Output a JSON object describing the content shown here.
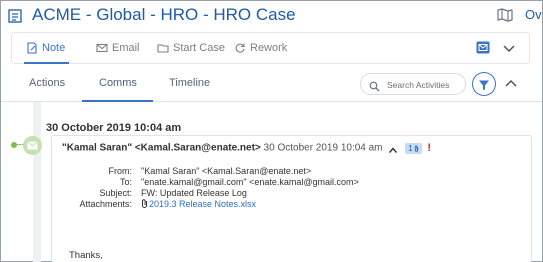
{
  "header": {
    "title": "ACME - Global - HRO - HRO Case",
    "overflow_text": "Ov"
  },
  "action_bar": {
    "buttons": [
      {
        "label": "Note",
        "icon": "note-icon"
      },
      {
        "label": "Email",
        "icon": "envelope-icon"
      },
      {
        "label": "Start Case",
        "icon": "folder-icon"
      },
      {
        "label": "Rework",
        "icon": "rework-icon"
      }
    ]
  },
  "tabs": [
    {
      "label": "Actions"
    },
    {
      "label": "Comms"
    },
    {
      "label": "Timeline"
    }
  ],
  "search": {
    "placeholder": "Search Activities"
  },
  "timeline": {
    "date_heading": "30 October 2019 10:04 am"
  },
  "email": {
    "sender": "\"Kamal Saran\" <Kamal.Saran@enate.net>",
    "date": "30 October 2019 10:04 am",
    "badge": "1",
    "important": "!",
    "labels": {
      "from": "From:",
      "to": "To:",
      "subject": "Subject:",
      "attachments": "Attachments:"
    },
    "from": "\"Kamal Saran\" <Kamal.Saran@enate.net>",
    "to": "\"enate.kamal@gmail.com\" <enate.kamal@gmail.com>",
    "subject": "FW: Updated Release Log",
    "attachment": "2019.3 Release Notes.xlsx",
    "body_start": "Thanks,"
  },
  "colors": {
    "title_blue": "#1e5aa8",
    "accent_blue": "#3b73c5",
    "link_blue": "#2a6fc9",
    "timeline_green": "#7cc04a",
    "important_red": "#e0251b"
  }
}
